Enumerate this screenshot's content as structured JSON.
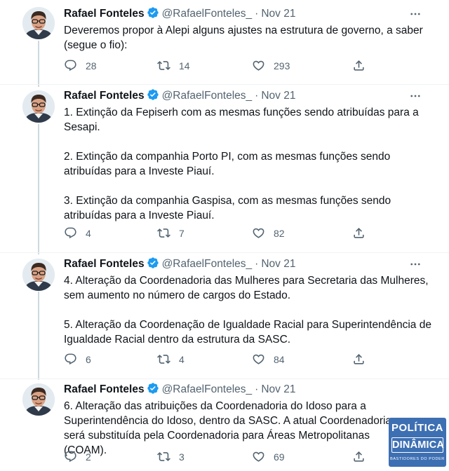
{
  "author": {
    "name": "Rafael Fonteles",
    "handle": "@RafaelFonteles_",
    "dot": "·"
  },
  "tweets": [
    {
      "date": "Nov 21",
      "paragraphs": [
        "Deveremos propor à Alepi alguns ajustes na estrutura de governo, a saber (segue o fio):"
      ],
      "replies": "28",
      "retweets": "14",
      "likes": "293"
    },
    {
      "date": "Nov 21",
      "paragraphs": [
        "1. Extinção da Fepiserh com as mesmas funções sendo atribuídas para a Sesapi.",
        "2. Extinção da companhia Porto PI, com as mesmas funções sendo atribuídas para a Investe Piauí.",
        "3. Extinção da companhia Gaspisa, com as mesmas funções sendo atribuídas para a Investe Piauí."
      ],
      "replies": "4",
      "retweets": "7",
      "likes": "82"
    },
    {
      "date": "Nov 21",
      "paragraphs": [
        "4. Alteração da Coordenadoria das Mulheres para Secretaria das Mulheres, sem aumento no número de cargos do Estado.",
        "5. Alteração da Coordenação de Igualdade Racial para Superintendência de Igualdade Racial dentro da estrutura da SASC."
      ],
      "replies": "6",
      "retweets": "4",
      "likes": "84"
    },
    {
      "date": "Nov 21",
      "paragraphs": [
        "6. Alteração das atribuições da Coordenadoria do Idoso para a Superintendência do Idoso, dentro da SASC. A atual Coordenadoria será substituída pela Coordenadoria para Áreas Metropolitanas (COAM)."
      ],
      "replies": "2",
      "retweets": "3",
      "likes": "69"
    }
  ],
  "watermark": {
    "line1": "POLÍTICA",
    "line2": "DINÂMICA",
    "line3": "BASTIDORES DO PODER"
  },
  "colors": {
    "text": "#0f1419",
    "secondary": "#536471",
    "verified": "#1d9bf0",
    "divider": "#eff3f4",
    "thread_line": "#cfd9de",
    "watermark_bg": "#3d6fb3"
  },
  "icons": {
    "verified": "verified-badge-icon",
    "more": "more-icon",
    "reply": "reply-icon",
    "retweet": "retweet-icon",
    "like": "like-icon",
    "share": "share-icon"
  }
}
